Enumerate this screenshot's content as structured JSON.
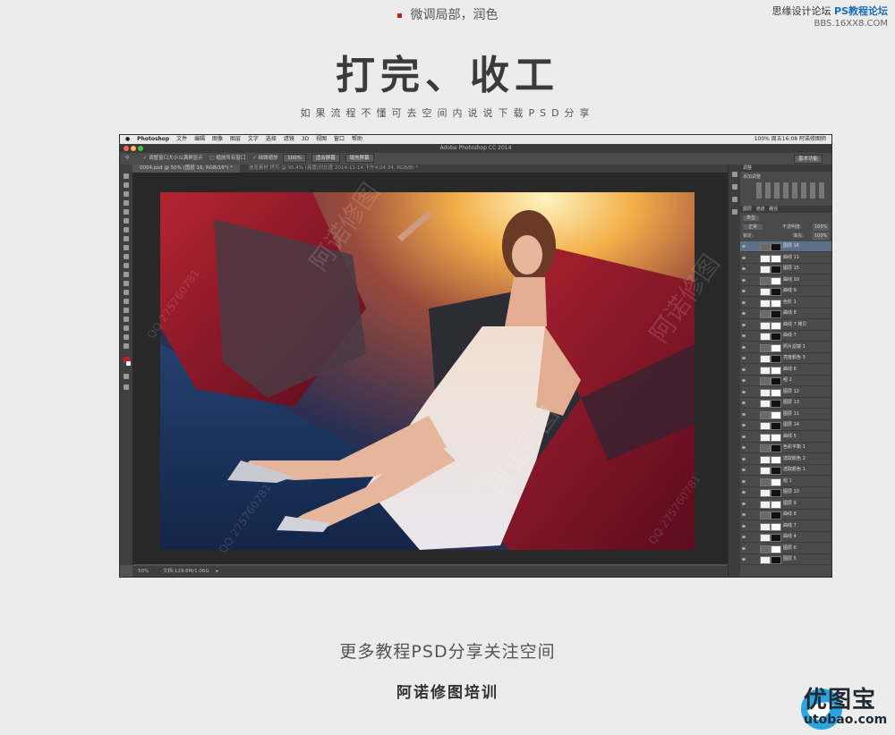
{
  "header": {
    "section_title": "微调局部，润色",
    "headline": "打完、收工",
    "sub_headline": "如果流程不懂可去空间内说说下载PSD分享",
    "site_mark_top": "思缘设计论坛",
    "site_mark_brand": "PS教程论坛",
    "site_mark_url": "BBS.16XX8.COM"
  },
  "photoshop": {
    "app_name": "Photoshop",
    "menus": [
      "文件",
      "编辑",
      "图像",
      "图层",
      "文字",
      "选择",
      "滤镜",
      "3D",
      "视图",
      "窗口",
      "帮助"
    ],
    "menubar_right": "100%  周五16:08  阿诺修图师",
    "window_title": "Adobe Photoshop CC 2014",
    "options": {
      "check1": "调整窗口大小以满屏显示",
      "check2": "缩放所有窗口",
      "check3": "细微缩放",
      "zoom": "100%",
      "btn_fit": "适合屏幕",
      "btn_fill": "填充屏幕",
      "workspace": "基本功能"
    },
    "tabs": {
      "active": "0004.psd @ 50% (图层 16, RGB/16*) *",
      "inactive": "信息素材 拷贝 @ 95.4% (亮度/对比度 2014-11-14 下午4.04.34, RGB/8) *"
    },
    "status": {
      "zoom": "50%",
      "doc": "文档:129.6M/1.06G"
    },
    "panels": {
      "history": "历史",
      "adjustments": "调整",
      "add_adjustment": "添加调整",
      "tabs": [
        "图层",
        "通道",
        "路径"
      ],
      "kind": "类型",
      "blend": "正常",
      "opacity_label": "不透明度:",
      "opacity": "100%",
      "lock_label": "锁定:",
      "fill_label": "填充:",
      "fill": "100%"
    },
    "layers": [
      {
        "name": "图层 16",
        "selected": true
      },
      {
        "name": "曲线 11",
        "selected": false
      },
      {
        "name": "图层 15",
        "selected": false
      },
      {
        "name": "曲线 10",
        "selected": false
      },
      {
        "name": "曲线 9",
        "selected": false
      },
      {
        "name": "色阶 1",
        "selected": false
      },
      {
        "name": "曲线 8",
        "selected": false
      },
      {
        "name": "曲线 7 拷贝",
        "selected": false
      },
      {
        "name": "曲线 7",
        "selected": false
      },
      {
        "name": "照片滤镜 1",
        "selected": false
      },
      {
        "name": "亮度颜色 3",
        "selected": false
      },
      {
        "name": "曲线 6",
        "selected": false
      },
      {
        "name": "组 2",
        "selected": false
      },
      {
        "name": "图层 12",
        "selected": false
      },
      {
        "name": "图层 13",
        "selected": false
      },
      {
        "name": "图层 11",
        "selected": false
      },
      {
        "name": "图层 14",
        "selected": false
      },
      {
        "name": "曲线 5",
        "selected": false
      },
      {
        "name": "色彩平衡 1",
        "selected": false
      },
      {
        "name": "选取颜色 2",
        "selected": false
      },
      {
        "name": "选取颜色 1",
        "selected": false
      },
      {
        "name": "组 1",
        "selected": false
      },
      {
        "name": "图层 10",
        "selected": false
      },
      {
        "name": "图层 9",
        "selected": false
      },
      {
        "name": "曲线 8",
        "selected": false
      },
      {
        "name": "曲线 7",
        "selected": false
      },
      {
        "name": "曲线 4",
        "selected": false
      },
      {
        "name": "图层 6",
        "selected": false
      },
      {
        "name": "图层 5",
        "selected": false
      }
    ],
    "watermark_main": "阿诺修图",
    "watermark_qq": "QQ 275760781"
  },
  "footer": {
    "line1": "更多教程PSD分享关注空间",
    "line2": "阿诺修图培训",
    "logo_text": "优图宝",
    "logo_url": "utobao.com"
  },
  "colors": {
    "background": "#ececec",
    "ps_dark": "#535353",
    "accent_red": "#c0201c",
    "logo_blue": "#2aa5e0"
  }
}
